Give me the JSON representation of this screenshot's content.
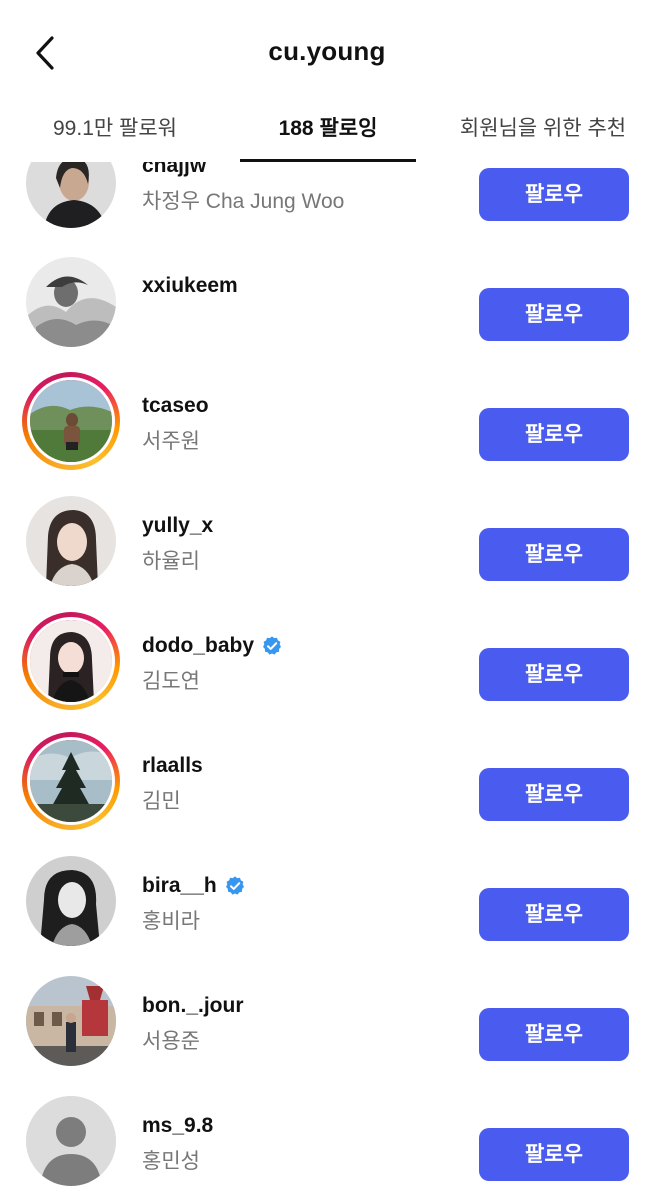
{
  "header": {
    "title": "cu.young"
  },
  "tabs": {
    "followers": "99.1만 팔로워",
    "following": "188 팔로잉",
    "suggested": "회원님을 위한 추천"
  },
  "colors": {
    "follow_button": "#4a5cf0",
    "verified_badge": "#3797f0"
  },
  "follow_label": "팔로우",
  "users": [
    {
      "username": "chajjw",
      "fullname": "차정우 Cha Jung Woo",
      "verified": false,
      "story": false,
      "button": "팔로우"
    },
    {
      "username": "xxiukeem",
      "fullname": "",
      "verified": false,
      "story": false,
      "button": "팔로우"
    },
    {
      "username": "tcaseo",
      "fullname": "서주원",
      "verified": false,
      "story": true,
      "button": "팔로우"
    },
    {
      "username": "yully_x",
      "fullname": "하율리",
      "verified": false,
      "story": false,
      "button": "팔로우"
    },
    {
      "username": "dodo_baby",
      "fullname": "김도연",
      "verified": true,
      "story": true,
      "button": "팔로우"
    },
    {
      "username": "rlaalls",
      "fullname": "김민",
      "verified": false,
      "story": true,
      "button": "팔로우"
    },
    {
      "username": "bira__h",
      "fullname": "홍비라",
      "verified": true,
      "story": false,
      "button": "팔로우"
    },
    {
      "username": "bon._.jour",
      "fullname": "서용준",
      "verified": false,
      "story": false,
      "button": "팔로우"
    },
    {
      "username": "ms_9.8",
      "fullname": "홍민성",
      "verified": false,
      "story": false,
      "button": "팔로우"
    }
  ]
}
